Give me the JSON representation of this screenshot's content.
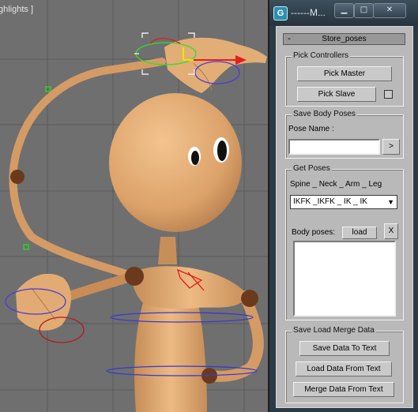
{
  "viewport": {
    "label": "ghlights ]"
  },
  "window": {
    "app_icon": "G",
    "title": "------M...",
    "min_icon": "minimize-icon",
    "max_icon": "maximize-icon",
    "close_icon": "close-icon"
  },
  "rollout": {
    "collapse_symbol": "-",
    "title": "Store_poses"
  },
  "pick_controllers": {
    "group_title": "Pick Controllers",
    "pick_master_label": "Pick Master",
    "pick_slave_label": "Pick Slave",
    "slave_checkbox_checked": false
  },
  "save_body_poses": {
    "group_title": "Save Body Poses",
    "pose_name_label": "Pose Name :",
    "pose_name_value": "",
    "save_button_label": ">"
  },
  "get_poses": {
    "group_title": "Get Poses",
    "columns_label": "Spine _ Neck _ Arm _ Leg",
    "dropdown_selected": "IKFK _IKFK _ IK _ IK",
    "body_poses_label": "Body poses:",
    "load_label": "load",
    "delete_label": "X",
    "poses_list": []
  },
  "text_io": {
    "group_title": "Save  Load  Merge Data",
    "save_to_text_label": "Save Data  To Text",
    "load_from_text_label": "Load  Data From Text",
    "merge_from_text_label": "Merge  Data From Text"
  },
  "colors": {
    "viewport_bg": "#6f6f6f",
    "grid": "#5a5a5a",
    "skin": "#e8b47e",
    "joint": "#6b3a1c",
    "window_bg": "#2b3a45",
    "panel_bg": "#b9b9b9"
  }
}
